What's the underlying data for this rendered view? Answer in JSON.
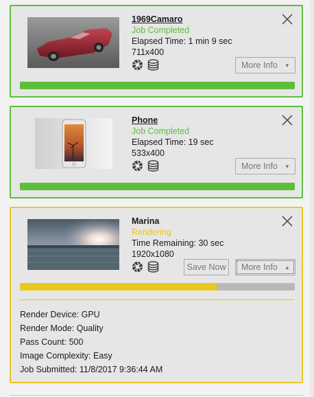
{
  "jobs": [
    {
      "title": "1969Camaro",
      "status": "Job Completed",
      "elapsed": "Elapsed Time: 1 min 9 sec",
      "resolution": "711x400",
      "more_info": "More Info",
      "progress": 1.0
    },
    {
      "title": "Phone",
      "status": "Job Completed",
      "elapsed": "Elapsed Time: 19 sec",
      "resolution": "533x400",
      "more_info": "More Info",
      "progress": 1.0
    },
    {
      "title": "Marina",
      "status": "Rendering",
      "remaining": "Time Remaining: 30 sec",
      "resolution": "1920x1080",
      "save_now": "Save Now",
      "more_info": "More Info",
      "progress": 0.715,
      "details": {
        "render_device": "Render Device: GPU",
        "render_mode": "Render Mode: Quality",
        "pass_count": "Pass Count: 500",
        "image_complexity": "Image Complexity: Easy",
        "job_submitted": "Job Submitted: 11/8/2017 9:36:44 AM"
      }
    }
  ],
  "colors": {
    "completed": "#5cbf3c",
    "rendering": "#e8c820",
    "track": "#b8b8b8"
  }
}
